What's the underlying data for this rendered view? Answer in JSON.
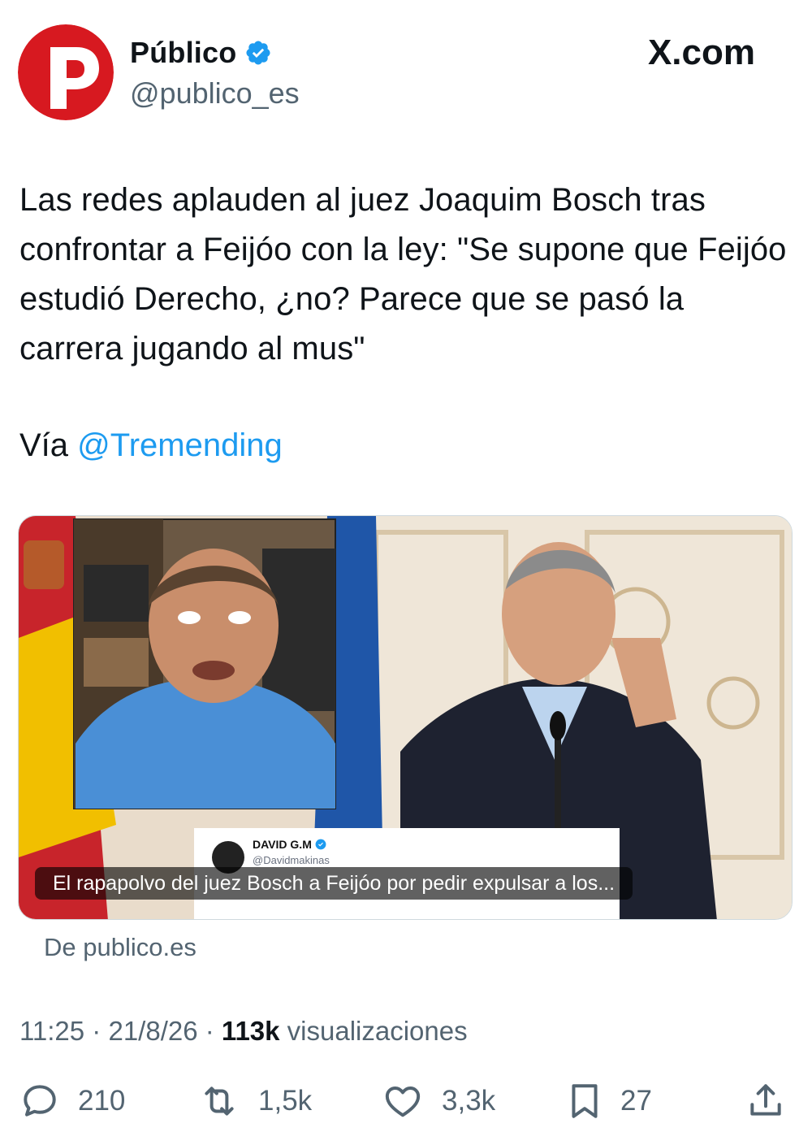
{
  "account": {
    "display_name": "Público",
    "handle": "@publico_es",
    "verified": true,
    "brand_color": "#d71920"
  },
  "site_badge": "X.com",
  "tweet": {
    "text": "Las redes aplauden al juez Joaquim Bosch tras confrontar a Feijóo con la ley: \"Se supone que Feijóo estudió Derecho, ¿no? Parece que se pasó la carrera jugando al mus\"",
    "via_prefix": "Vía ",
    "via_mention": "@Tremending"
  },
  "media": {
    "caption": "El rapapolvo del juez Bosch a Feijóo por pedir expulsar a los...",
    "embedded_post": {
      "name": "DAVID G.M",
      "handle": "@Davidmakinas",
      "verified": true
    },
    "source": "De publico.es"
  },
  "meta": {
    "time": "11:25",
    "date": "21/8/26",
    "views": "113k",
    "views_label": "visualizaciones",
    "separator": " · "
  },
  "actions": {
    "replies": "210",
    "reposts": "1,5k",
    "likes": "3,3k",
    "bookmarks": "27"
  },
  "icons": [
    "verified-badge-icon",
    "x-logo-icon",
    "reply-icon",
    "repost-icon",
    "like-icon",
    "bookmark-icon",
    "share-icon"
  ],
  "colors": {
    "link": "#1d9bf0",
    "secondary_text": "#536471",
    "primary_text": "#0f1419"
  }
}
